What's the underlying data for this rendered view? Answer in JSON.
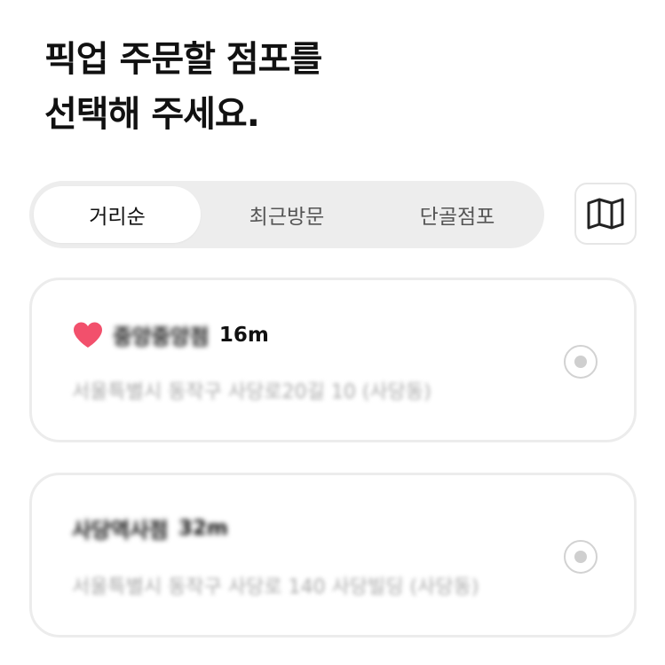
{
  "heading": {
    "line1": "픽업 주문할 점포를",
    "line2": "선택해 주세요."
  },
  "sort_tabs": [
    {
      "label": "거리순",
      "selected": true
    },
    {
      "label": "최근방문",
      "selected": false
    },
    {
      "label": "단골점포",
      "selected": false
    }
  ],
  "map_button": {
    "icon": "map-icon"
  },
  "stores": [
    {
      "name": "중앙중앙점",
      "favorite": true,
      "distance": "16m",
      "address": "서울특별시 동작구 사당로20길 10 (사당동)",
      "radio_selected": false
    },
    {
      "name": "사당역사점",
      "favorite": false,
      "distance": "32m",
      "address": "서울특별시 동작구 사당로 140 사당빌딩 (사당동)",
      "radio_selected": false
    }
  ],
  "colors": {
    "heart": "#f2506c",
    "segment_bg": "#ededed",
    "card_border": "#ececec",
    "radio": "#cfcfcf"
  }
}
